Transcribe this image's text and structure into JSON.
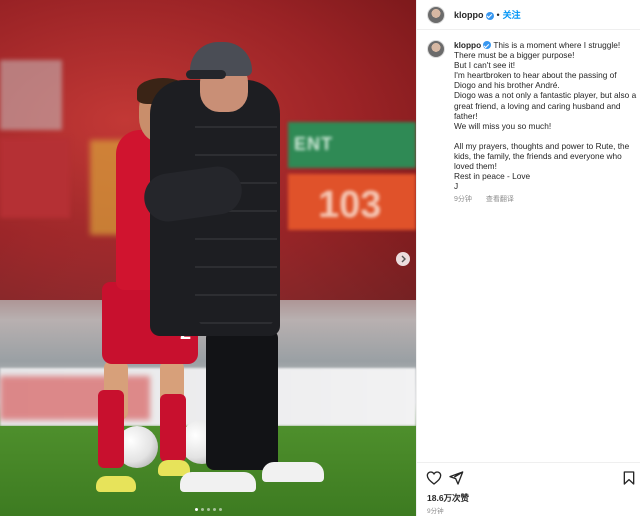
{
  "post": {
    "username": "kloppo",
    "follow_label": "关注",
    "header_separator": "•",
    "caption_lines": [
      "This is a moment where I struggle!",
      "There must be a bigger purpose!",
      "But I can't see it!",
      "I'm heartbroken to hear about the passing of Diogo and his brother André.",
      "Diogo was a not only a fantastic player, but also a great friend, a loving and caring husband and father!",
      "We will miss you so much!",
      "",
      "All my prayers, thoughts and power to Rute, the kids, the family, the friends and everyone who loved them!",
      "Rest in peace - Love",
      "J"
    ],
    "comment_time": "9分钟",
    "translate_label": "查看翻译",
    "likes": "18.6万次赞",
    "post_time": "9分钟"
  },
  "photo": {
    "jersey_number": "2",
    "board_number": "103",
    "board_text": "ENT"
  },
  "icons": {
    "heart": "heart-icon",
    "share": "paper-plane-icon",
    "save": "bookmark-icon",
    "next": "chevron-right-icon",
    "verified": "verified-badge-icon"
  },
  "colors": {
    "link_blue": "#0095f6",
    "verified_blue": "#3897f0",
    "liverpool_red": "#c8102e"
  }
}
